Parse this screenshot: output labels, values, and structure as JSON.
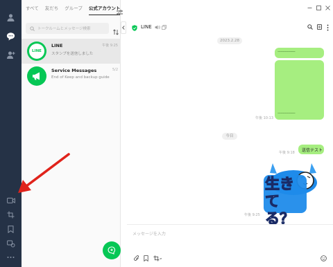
{
  "tabs": [
    "すべて",
    "友だち",
    "グループ",
    "公式アカウント"
  ],
  "active_tab": 3,
  "search": {
    "placeholder": "トークルームとメッセージ検索"
  },
  "chats": [
    {
      "name": "LINE",
      "preview": "スタンプを送信しました",
      "time": "午後 9:25",
      "avatar_label": "LINE"
    },
    {
      "name": "Service Messages",
      "preview": "End of Keep and backup guide",
      "time": "5/2"
    }
  ],
  "conversation": {
    "title": "LINE",
    "messages": [
      {
        "type": "date",
        "text": "2023.2.28"
      },
      {
        "type": "bubble-text",
        "text": "-----------------"
      },
      {
        "type": "bubble-text",
        "text": "-----------------"
      },
      {
        "type": "time",
        "text": "午後 10:13"
      },
      {
        "type": "date",
        "text": "今日"
      },
      {
        "type": "time",
        "text": "午後 9:18"
      },
      {
        "type": "bubble-text",
        "text": "送信テスト"
      },
      {
        "type": "sticker",
        "text": "生きてる？"
      },
      {
        "type": "time",
        "text": "午後 9:25"
      }
    ]
  },
  "composer": {
    "placeholder": "メッセージを入力"
  },
  "colors": {
    "rail": "#253246",
    "accent": "#06c755",
    "bubble": "#a6ee80",
    "arrow": "#e0231b"
  }
}
